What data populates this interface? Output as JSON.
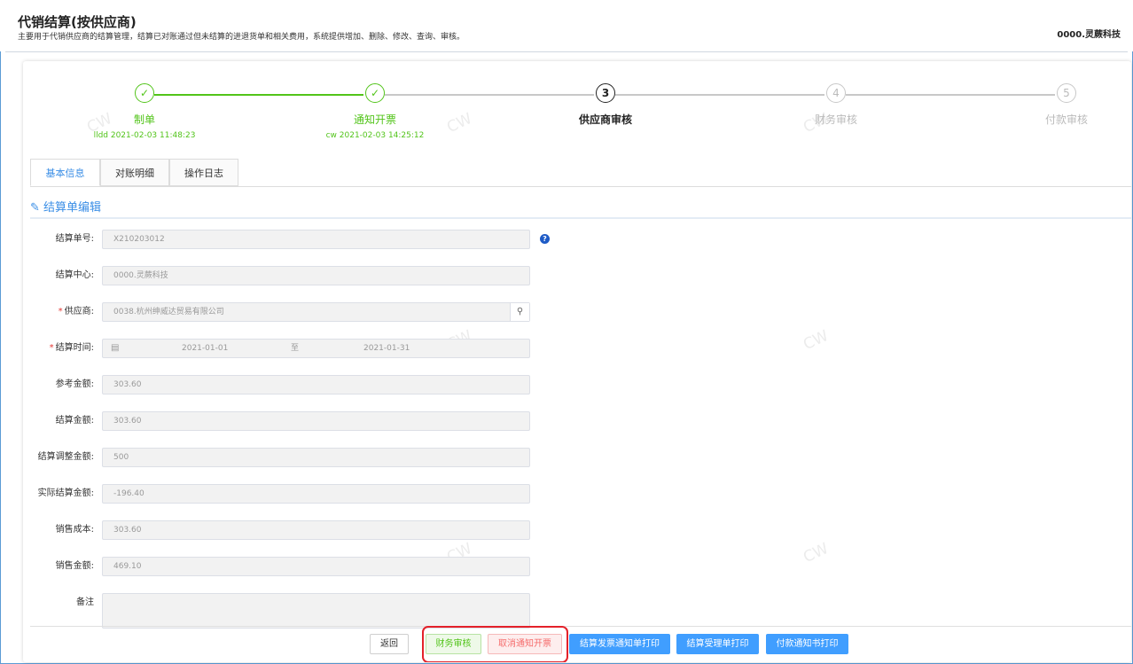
{
  "header": {
    "title": "代销结算(按供应商)",
    "description": "主要用于代销供应商的结算管理，结算已对账通过但未结算的进退货单和相关费用，系统提供增加、删除、修改、查询、审核。",
    "tenant": "0000.灵蕨科技"
  },
  "steps": [
    {
      "num": "✓",
      "title": "制单",
      "time": "lldd 2021-02-03 11:48:23",
      "status": "done"
    },
    {
      "num": "✓",
      "title": "通知开票",
      "time": "cw 2021-02-03 14:25:12",
      "status": "done"
    },
    {
      "num": "3",
      "title": "供应商审核",
      "time": "",
      "status": "active"
    },
    {
      "num": "4",
      "title": "财务审核",
      "time": "",
      "status": "wait"
    },
    {
      "num": "5",
      "title": "付款审核",
      "time": "",
      "status": "wait"
    }
  ],
  "tabs": [
    "基本信息",
    "对账明细",
    "操作日志"
  ],
  "section_title": "结算单编辑",
  "form": {
    "settle_no": {
      "label": "结算单号:",
      "value": "X210203012"
    },
    "center": {
      "label": "结算中心:",
      "value": "0000.灵蕨科技"
    },
    "supplier": {
      "label": "供应商:",
      "value": "0038.杭州绅威达贸易有限公司"
    },
    "period": {
      "label": "结算时间:",
      "start": "2021-01-01",
      "sep": "至",
      "end": "2021-01-31"
    },
    "ref_amount": {
      "label": "参考金额:",
      "value": "303.60"
    },
    "settle_amount": {
      "label": "结算金额:",
      "value": "303.60"
    },
    "adjust_amount": {
      "label": "结算调整金额:",
      "value": "500"
    },
    "actual_amount": {
      "label": "实际结算金额:",
      "value": "-196.40"
    },
    "sales_cost": {
      "label": "销售成本:",
      "value": "303.60"
    },
    "sales_amount": {
      "label": "销售金额:",
      "value": "469.10"
    },
    "remark": {
      "label": "备注",
      "value": ""
    }
  },
  "buttons": {
    "back": "返回",
    "finance_audit": "财务审核",
    "cancel_invoice": "取消通知开票",
    "print_invoice_notice": "结算发票通知单打印",
    "print_accept": "结算受理单打印",
    "print_payment": "付款通知书打印"
  },
  "watermark": "CW",
  "colors": {
    "primary": "#409eff",
    "success": "#52c41a",
    "danger": "#f56c6c",
    "highlight": "#e4212a"
  }
}
